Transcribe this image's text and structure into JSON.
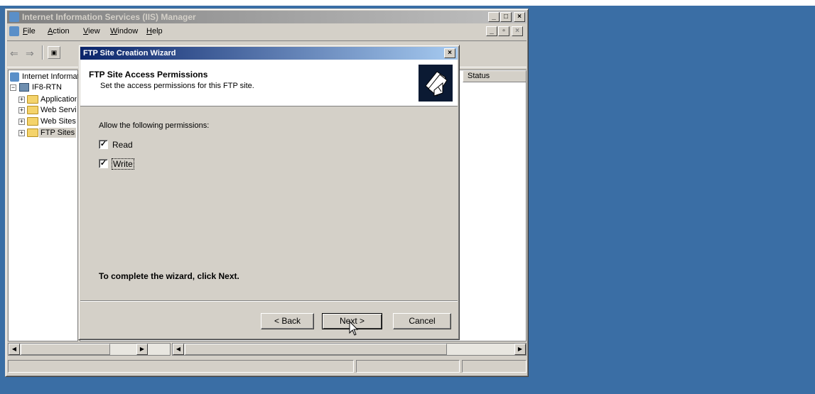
{
  "main_window": {
    "title": "Internet Information Services (IIS) Manager",
    "menu": [
      {
        "key": "file",
        "label": "File"
      },
      {
        "key": "action",
        "label": "Action"
      },
      {
        "key": "view",
        "label": "View"
      },
      {
        "key": "window",
        "label": "Window"
      },
      {
        "key": "help",
        "label": "Help"
      }
    ],
    "tree": {
      "root": "Internet Information Services",
      "server": "IF8-RTN",
      "children": [
        "Application Pools",
        "Web Service Extensions",
        "Web Sites",
        "FTP Sites"
      ]
    },
    "list_header": {
      "status": "Status"
    }
  },
  "wizard": {
    "title": "FTP Site Creation Wizard",
    "heading": "FTP Site Access Permissions",
    "subheading": "Set the access permissions for this FTP site.",
    "instruction": "Allow the following permissions:",
    "permissions": [
      {
        "label": "Read",
        "checked": true
      },
      {
        "label": "Write",
        "checked": true
      }
    ],
    "completion_text": "To complete the wizard, click Next.",
    "buttons": {
      "back": "< Back",
      "next": "Next >",
      "cancel": "Cancel"
    }
  },
  "colors": {
    "desktop": "#3a6ea5",
    "active_title": "#0a246a",
    "inactive_title": "#808080",
    "face": "#d4d0c8"
  }
}
